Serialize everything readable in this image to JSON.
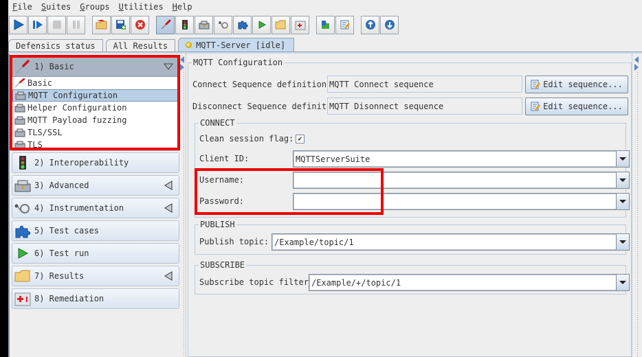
{
  "menubar": {
    "items": [
      {
        "label_first": "F",
        "label_rest": "ile"
      },
      {
        "label_first": "S",
        "label_rest": "uites"
      },
      {
        "label_first": "G",
        "label_rest": "roups"
      },
      {
        "label_first": "U",
        "label_rest": "tilities"
      },
      {
        "label_first": "H",
        "label_rest": "elp"
      }
    ]
  },
  "toolbar": {
    "buttons": [
      {
        "name": "start-run",
        "icon": "play-icon"
      },
      {
        "name": "step-run",
        "icon": "step-forward-icon"
      },
      {
        "name": "stop",
        "icon": "stop-icon"
      },
      {
        "name": "pause",
        "icon": "pause-icon"
      },
      {
        "name": "open",
        "icon": "open-folder-icon"
      },
      {
        "name": "save",
        "icon": "save-icon"
      },
      {
        "name": "close",
        "icon": "close-icon"
      },
      {
        "name": "basic",
        "icon": "screwdriver-icon",
        "active": true
      },
      {
        "name": "interoperability",
        "icon": "traffic-light-icon"
      },
      {
        "name": "advanced",
        "icon": "toolbox-icon"
      },
      {
        "name": "instrumentation",
        "icon": "stethoscope-icon"
      },
      {
        "name": "test-cases",
        "icon": "puzzle-icon"
      },
      {
        "name": "test-run",
        "icon": "green-play-icon"
      },
      {
        "name": "results",
        "icon": "folder-icon"
      },
      {
        "name": "remediation",
        "icon": "first-aid-icon"
      },
      {
        "name": "plugins",
        "icon": "puzzle-green-icon"
      },
      {
        "name": "edit",
        "icon": "edit-icon"
      },
      {
        "name": "move-up",
        "icon": "arrow-up-icon"
      },
      {
        "name": "move-down",
        "icon": "arrow-down-icon"
      }
    ]
  },
  "tabs": [
    {
      "label": "Defensics status"
    },
    {
      "label": "All Results"
    },
    {
      "label": "MQTT-Server [idle]",
      "status": "idle",
      "selected": true
    }
  ],
  "sidebar": {
    "groups": [
      {
        "label": "1) Basic",
        "expanded": true,
        "items": [
          {
            "label": "Basic",
            "icon": "screwdriver-icon"
          },
          {
            "label": "MQTT Configuration",
            "icon": "toolbox-icon",
            "selected": true
          },
          {
            "label": "Helper Configuration",
            "icon": "toolbox-icon"
          },
          {
            "label": "MQTT Payload fuzzing",
            "icon": "toolbox-icon"
          },
          {
            "label": "TLS/SSL",
            "icon": "toolbox-icon"
          },
          {
            "label": "TLS",
            "icon": "toolbox-icon"
          }
        ]
      },
      {
        "label": "2) Interoperability",
        "has_arrow": false
      },
      {
        "label": "3) Advanced",
        "has_arrow": true
      },
      {
        "label": "4) Instrumentation",
        "has_arrow": true
      },
      {
        "label": "5) Test cases",
        "has_arrow": false
      },
      {
        "label": "6) Test run",
        "has_arrow": false
      },
      {
        "label": "7) Results",
        "has_arrow": true
      },
      {
        "label": "8) Remediation",
        "has_arrow": false
      }
    ]
  },
  "main": {
    "section_title": "MQTT Configuration",
    "connect_sequence": {
      "label": "Connect Sequence definition:",
      "value": "MQTT Connect sequence",
      "button": "Edit sequence..."
    },
    "disconnect_sequence": {
      "label": "Disconnect Sequence definition:",
      "value": "MQTT Disonnect sequence",
      "button": "Edit sequence..."
    },
    "connect": {
      "title": "CONNECT",
      "clean_session_label": "Clean session flag:",
      "clean_session_checked": true,
      "client_id_label": "Client ID:",
      "client_id_value": "MQTTServerSuite",
      "username_label": "Username:",
      "username_value": "",
      "password_label": "Password:",
      "password_value": ""
    },
    "publish": {
      "title": "PUBLISH",
      "topic_label": "Publish topic:",
      "topic_value": "/Example/topic/1"
    },
    "subscribe": {
      "title": "SUBSCRIBE",
      "filter_label": "Subscribe topic filter:",
      "filter_value": "/Example/+/topic/1"
    }
  },
  "colors": {
    "highlight_box": "#ee0000",
    "selected_tab": "#c7daef",
    "selected_item": "#b8cfe6"
  }
}
